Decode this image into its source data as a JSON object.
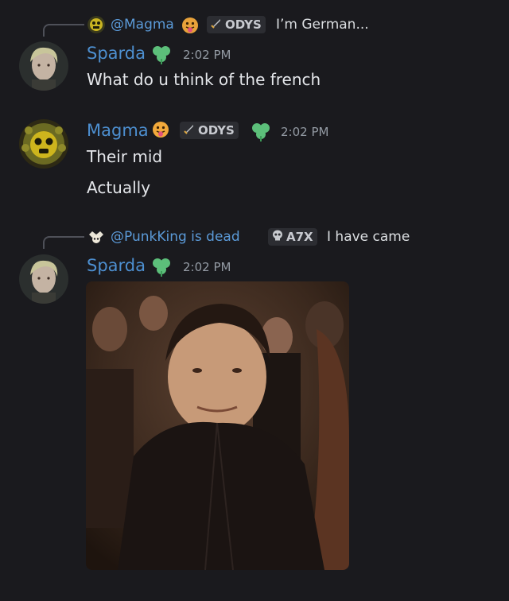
{
  "messages": [
    {
      "reply": {
        "name": "@Magma",
        "tag": "ODYS",
        "text": "I’m German..."
      },
      "author": "Sparda",
      "time": "2:02 PM",
      "lines": [
        "What do u think of the french"
      ]
    },
    {
      "author": "Magma",
      "tag": "ODYS",
      "time": "2:02 PM",
      "lines": [
        "Their mid",
        "Actually"
      ]
    },
    {
      "reply": {
        "name": "@PunkKing is dead",
        "tag": "A7X",
        "text": "I have came"
      },
      "author": "Sparda",
      "time": "2:02 PM",
      "attachment": "gif"
    }
  ],
  "colors": {
    "background": "#1a1a1e",
    "username": "#4d8fd0",
    "reply_name": "#5b9ad8",
    "leaf_badge": "#5cbf7a",
    "tag_bg": "#2c2d32"
  },
  "icons": [
    "sword-icon",
    "skull-icon",
    "clover-badge-icon",
    "tongue-face-emoji"
  ]
}
